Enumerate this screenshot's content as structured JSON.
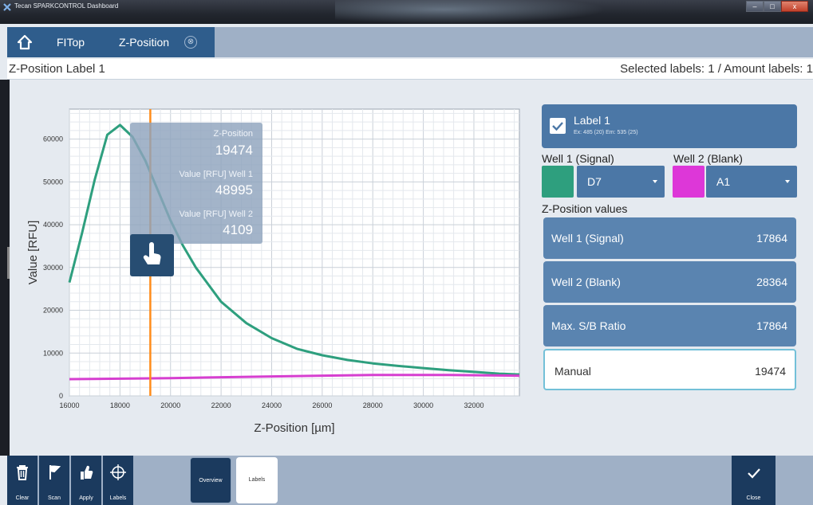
{
  "window": {
    "title": "Tecan SPARKCONTROL Dashboard",
    "icon": "tecan-logo-icon"
  },
  "nav": {
    "home_icon": "home-icon",
    "crumbs": [
      {
        "label": "FITop"
      },
      {
        "label": "Z-Position"
      }
    ],
    "tab_close": "⊗"
  },
  "header": {
    "left": "Z-Position Label 1",
    "right": "Selected labels: 1 / Amount labels: 1"
  },
  "plot": {
    "tooltip": {
      "zpos_label": "Z-Position",
      "zpos_value": "19474",
      "w1_label": "Value [RFU] Well 1",
      "w1_value": "48995",
      "w2_label": "Value [RFU] Well 2",
      "w2_value": "4109"
    }
  },
  "chart_data": {
    "type": "line",
    "xlabel": "Z-Position [µm]",
    "ylabel": "Value [RFU]",
    "xlim": [
      16000,
      33800
    ],
    "ylim": [
      0,
      67000
    ],
    "x_ticks": [
      16000,
      18000,
      20000,
      22000,
      24000,
      26000,
      28000,
      30000,
      32000
    ],
    "y_ticks": [
      0,
      10000,
      20000,
      30000,
      40000,
      50000,
      60000
    ],
    "cursor_x": 19200,
    "grid": true,
    "colors": {
      "well1": "#2e9f7e",
      "well2": "#d63fd0",
      "cursor": "#ff8c1a"
    },
    "series": [
      {
        "key": "well1",
        "x": [
          16000,
          16500,
          17000,
          17500,
          18000,
          18500,
          19000,
          19500,
          20000,
          20500,
          21000,
          22000,
          23000,
          24000,
          25000,
          26000,
          27000,
          28000,
          29000,
          30000,
          31000,
          32000,
          33000,
          33800
        ],
        "values": [
          26500,
          38000,
          50500,
          61000,
          63300,
          60500,
          55000,
          48000,
          41000,
          35000,
          30000,
          22000,
          17000,
          13500,
          11000,
          9500,
          8400,
          7600,
          7000,
          6500,
          6000,
          5600,
          5200,
          5000
        ]
      },
      {
        "key": "well2",
        "x": [
          16000,
          20000,
          24000,
          28000,
          31000,
          33800
        ],
        "values": [
          3900,
          4150,
          4550,
          4900,
          4900,
          4700
        ]
      }
    ]
  },
  "label_card": {
    "title": "Label 1",
    "subtitle": "Ex: 485 (20) Em: 535 (25)",
    "checked": true
  },
  "wells": {
    "well1": {
      "heading": "Well 1 (Signal)",
      "value": "D7",
      "color": "#2e9f7e"
    },
    "well2": {
      "heading": "Well 2 (Blank)",
      "value": "A1",
      "color": "#dd37d8"
    }
  },
  "zpos": {
    "title": "Z-Position values",
    "rows": [
      {
        "label": "Well 1 (Signal)",
        "value": "17864"
      },
      {
        "label": "Well 2 (Blank)",
        "value": "28364"
      },
      {
        "label": "Max. S/B Ratio",
        "value": "17864"
      },
      {
        "label": "Manual",
        "value": "19474"
      }
    ]
  },
  "toolbar": {
    "clear": "Clear",
    "scan": "Scan",
    "apply": "Apply",
    "labels_tool": "Labels",
    "overview": "Overview",
    "labels_seg": "Labels",
    "close": "Close"
  }
}
